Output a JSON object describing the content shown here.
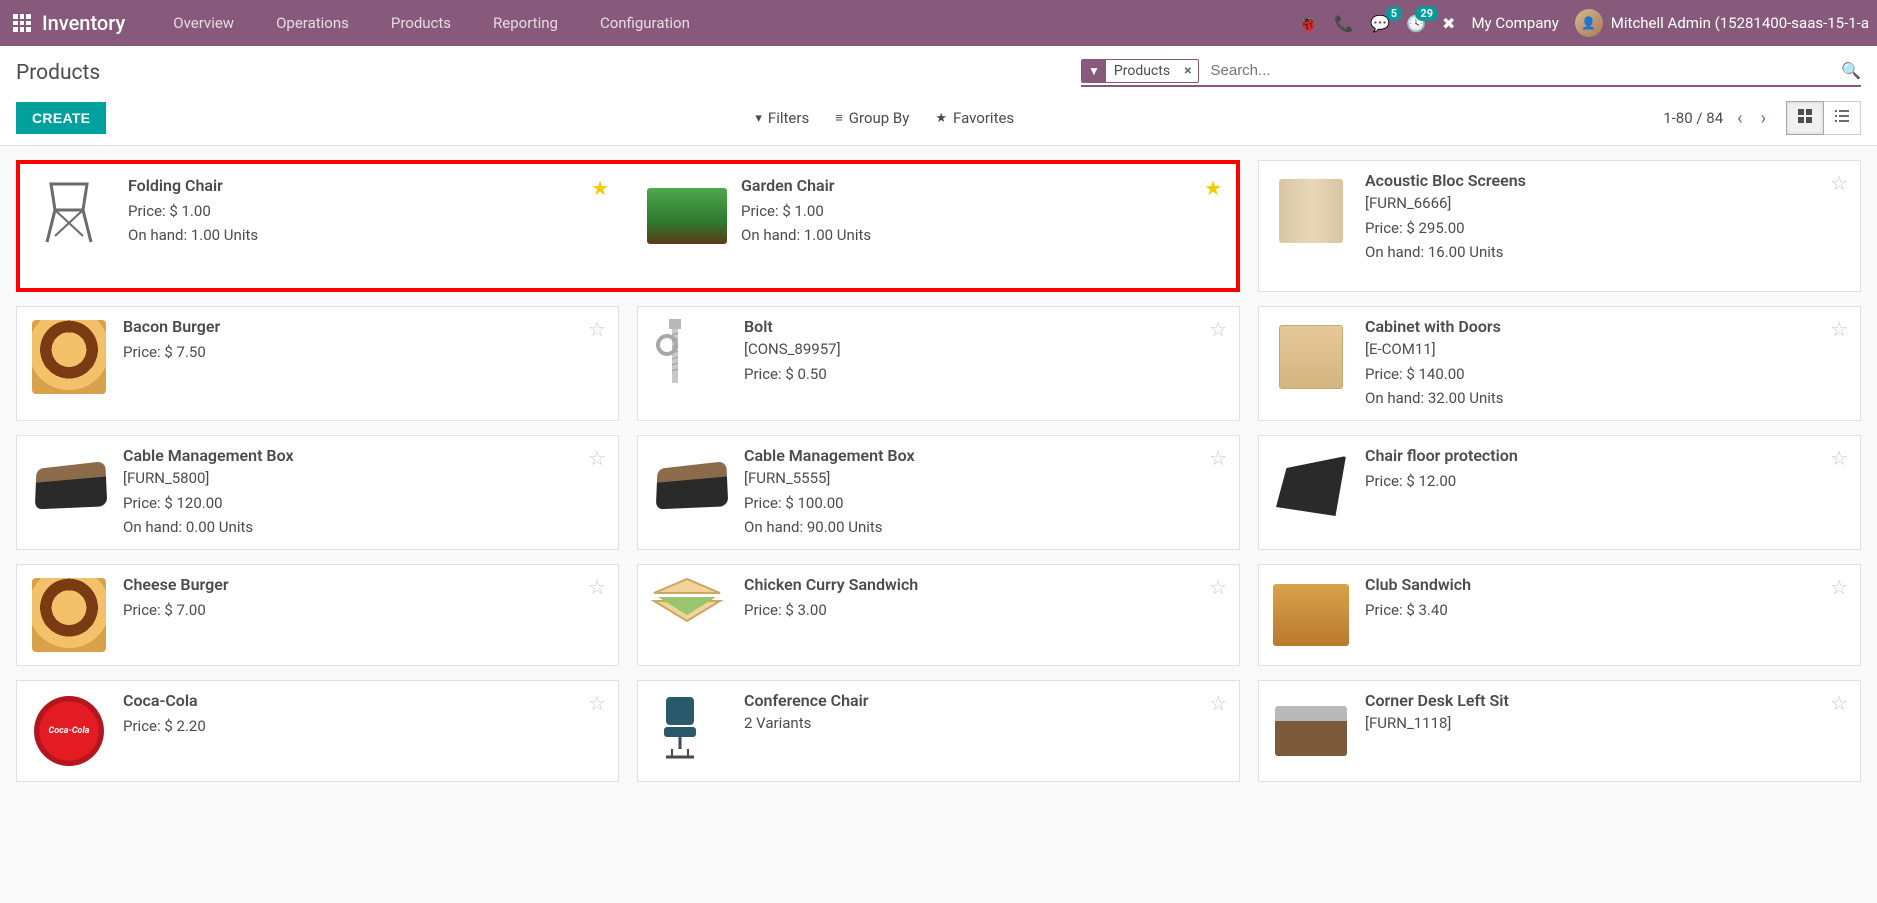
{
  "topbar": {
    "brand": "Inventory",
    "nav": [
      "Overview",
      "Operations",
      "Products",
      "Reporting",
      "Configuration"
    ],
    "badge_msg": "5",
    "badge_activity": "29",
    "company": "My Company",
    "user": "Mitchell Admin (15281400-saas-15-1-a"
  },
  "control": {
    "breadcrumb": "Products",
    "facet_label": "Products",
    "search_placeholder": "Search...",
    "create": "CREATE",
    "filters": "Filters",
    "groupby": "Group By",
    "favorites": "Favorites",
    "pager": "1-80 / 84"
  },
  "products": [
    {
      "name": "Folding Chair",
      "price": "Price: $ 1.00",
      "onhand": "On hand: 1.00 Units",
      "fav": true,
      "img": "chair-fold",
      "highlight": true
    },
    {
      "name": "Garden Chair",
      "price": "Price: $ 1.00",
      "onhand": "On hand: 1.00 Units",
      "fav": true,
      "img": "garden",
      "highlight": true
    },
    {
      "name": "Acoustic Bloc Screens",
      "ref": "[FURN_6666]",
      "price": "Price: $ 295.00",
      "onhand": "On hand: 16.00 Units",
      "fav": false,
      "img": "screens"
    },
    {
      "name": "Bacon Burger",
      "price": "Price: $ 7.50",
      "fav": false,
      "img": "burger"
    },
    {
      "name": "Bolt",
      "ref": "[CONS_89957]",
      "price": "Price: $ 0.50",
      "fav": false,
      "img": "bolt"
    },
    {
      "name": "Cabinet with Doors",
      "ref": "[E-COM11]",
      "price": "Price: $ 140.00",
      "onhand": "On hand: 32.00 Units",
      "fav": false,
      "img": "cabinet"
    },
    {
      "name": "Cable Management Box",
      "ref": "[FURN_5800]",
      "price": "Price: $ 120.00",
      "onhand": "On hand: 0.00 Units",
      "fav": false,
      "img": "cablebox"
    },
    {
      "name": "Cable Management Box",
      "ref": "[FURN_5555]",
      "price": "Price: $ 100.00",
      "onhand": "On hand: 90.00 Units",
      "fav": false,
      "img": "cablebox"
    },
    {
      "name": "Chair floor protection",
      "price": "Price: $ 12.00",
      "fav": false,
      "img": "mat"
    },
    {
      "name": "Cheese Burger",
      "price": "Price: $ 7.00",
      "fav": false,
      "img": "burger"
    },
    {
      "name": "Chicken Curry Sandwich",
      "price": "Price: $ 3.00",
      "fav": false,
      "img": "sandwich"
    },
    {
      "name": "Club Sandwich",
      "price": "Price: $ 3.40",
      "fav": false,
      "img": "club"
    },
    {
      "name": "Coca-Cola",
      "price": "Price: $ 2.20",
      "fav": false,
      "img": "cola"
    },
    {
      "name": "Conference Chair",
      "ref": "2 Variants",
      "fav": false,
      "img": "confchair"
    },
    {
      "name": "Corner Desk Left Sit",
      "ref": "[FURN_1118]",
      "fav": false,
      "img": "desk"
    }
  ]
}
